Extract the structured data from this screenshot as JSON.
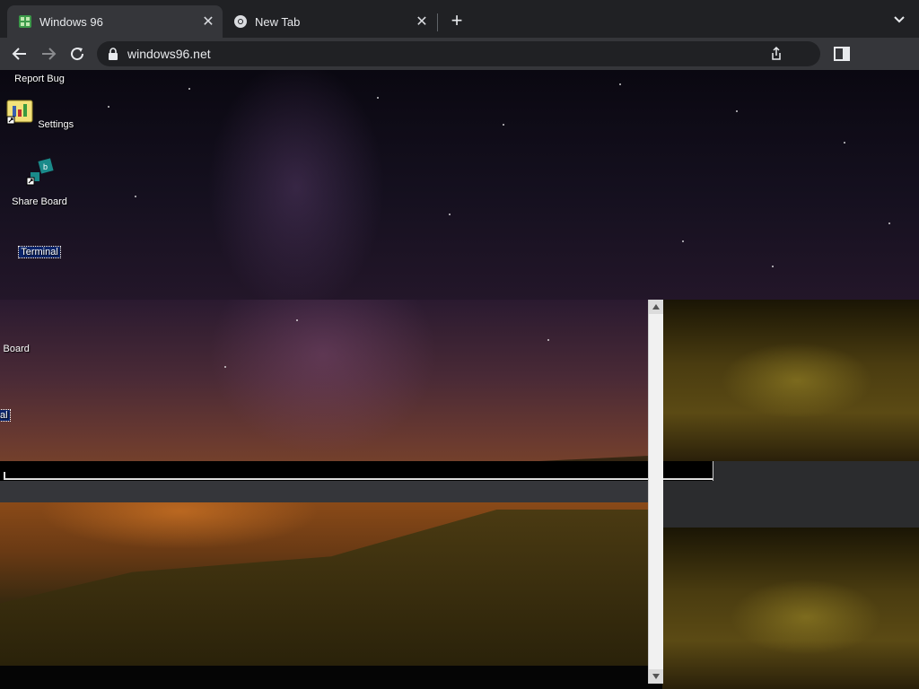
{
  "browser": {
    "tabs": [
      {
        "title": "Windows 96",
        "active": true,
        "favicon": "windows96-favicon"
      },
      {
        "title": "New Tab",
        "active": false,
        "favicon": "chrome-icon"
      }
    ],
    "new_tab_label": "+",
    "close_label": "✕",
    "url": "windows96.net"
  },
  "desktop": {
    "icons": [
      {
        "label": "Report Bug",
        "icon": "report-bug-icon"
      },
      {
        "label": "Settings",
        "icon": "settings-icon"
      },
      {
        "label": "Share Board",
        "icon": "share-board-icon"
      },
      {
        "label": "Terminal",
        "icon": "terminal-icon",
        "selected": true
      }
    ],
    "duplicate_icons": [
      {
        "label": "Board"
      },
      {
        "label": "inal"
      }
    ]
  }
}
